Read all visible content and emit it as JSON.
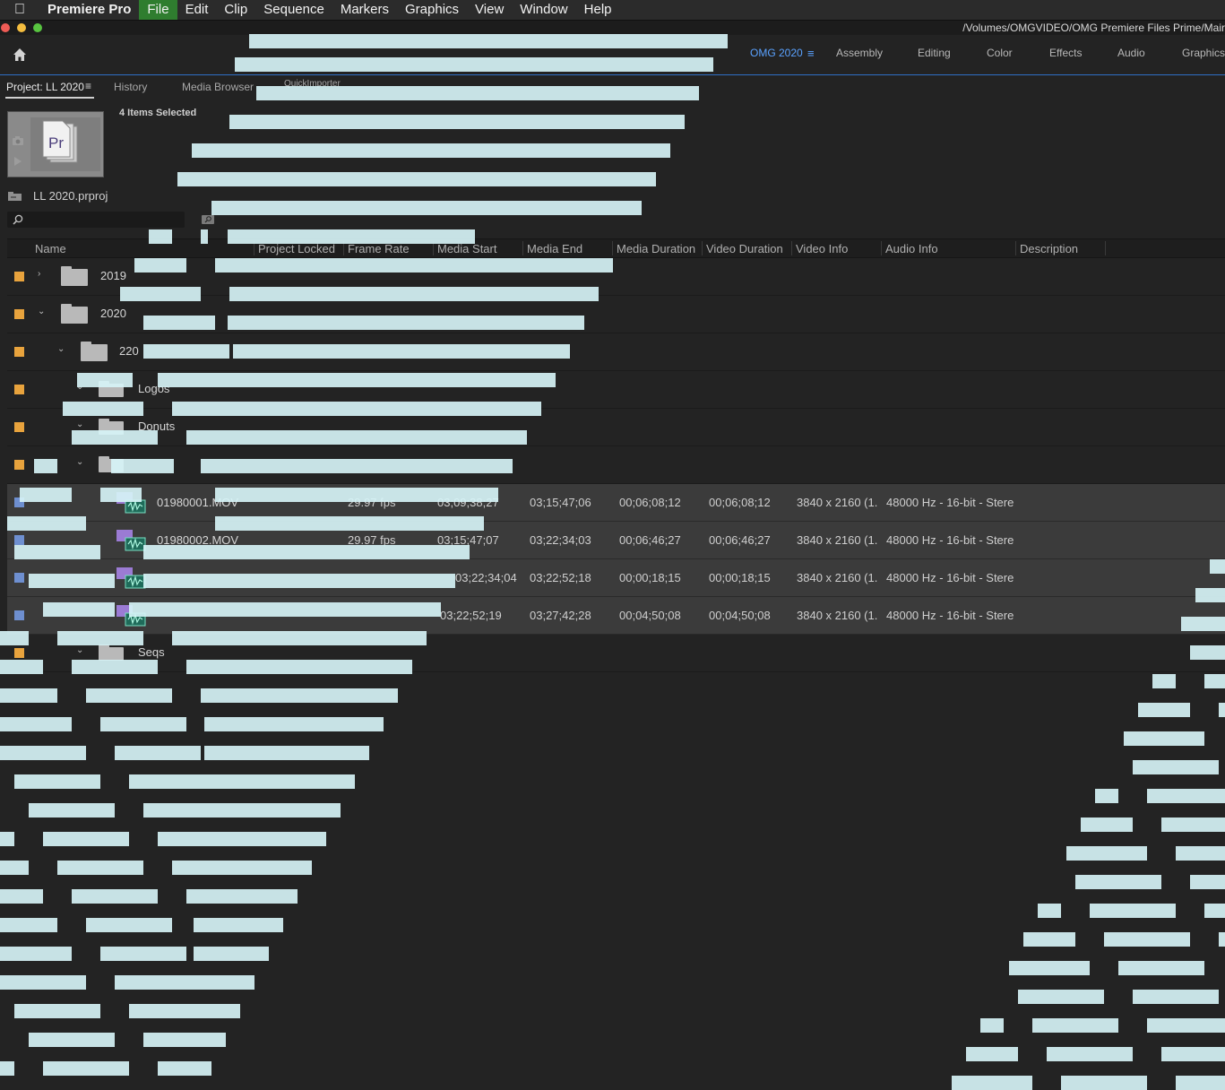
{
  "menubar": {
    "apple_icon": "apple-logo",
    "app_name": "Premiere Pro",
    "items": [
      "File",
      "Edit",
      "Clip",
      "Sequence",
      "Markers",
      "Graphics",
      "View",
      "Window",
      "Help"
    ],
    "active_item": "File"
  },
  "window": {
    "title": "/Volumes/OMGVIDEO/OMG Premiere Files Prime/Mair"
  },
  "workspaces": {
    "home_icon": "home-icon",
    "active": "OMG 2020",
    "tabs": [
      "OMG 2020",
      "Assembly",
      "Editing",
      "Color",
      "Effects",
      "Audio",
      "Graphics"
    ],
    "accent_color": "#5aa2ff"
  },
  "panel_tabs": {
    "project": "Project: LL 2020",
    "history": "History",
    "media_browser": "Media Browser",
    "quick_importer": "QuickImporter"
  },
  "project": {
    "items_selected": "4 Items Selected",
    "file_name": "LL 2020.prproj",
    "thumbnail_label": "Pr",
    "search_value": ""
  },
  "columns": [
    "Name",
    "Project Locked",
    "Frame Rate",
    "Media Start",
    "Media End",
    "Media Duration",
    "Video Duration",
    "Video Info",
    "Audio Info",
    "Description"
  ],
  "rows": [
    {
      "name": "2019",
      "type": "folder",
      "twisty": "›",
      "color": "#e8a33d"
    },
    {
      "name": "2020",
      "type": "folder",
      "twisty": "⌄",
      "color": "#e8a33d"
    },
    {
      "name": "220",
      "type": "folder",
      "twisty": "⌄",
      "color": "#e8a33d"
    },
    {
      "name": "Logos",
      "type": "folder",
      "twisty": "⌄",
      "color": "#e8a33d"
    },
    {
      "name": "Donuts",
      "type": "folder",
      "twisty": "⌄",
      "color": "#e8a33d"
    },
    {
      "name": "",
      "type": "folder",
      "twisty": "⌄",
      "color": "#e8a33d"
    },
    {
      "name": "01980001.MOV",
      "type": "clip",
      "color": "#6e8fd0",
      "frame_rate": "29.97 fps",
      "media_start": "03;09;38;27",
      "media_end": "03;15;47;06",
      "media_duration": "00;06;08;12",
      "video_duration": "00;06;08;12",
      "video_info": "3840 x 2160 (1.",
      "audio_info": "48000 Hz - 16-bit - Stere"
    },
    {
      "name": "01980002.MOV",
      "type": "clip",
      "color": "#6e8fd0",
      "frame_rate": "29.97 fps",
      "media_start": "03;15;47;07",
      "media_end": "03;22;34;03",
      "media_duration": "00;06;46;27",
      "video_duration": "00;06;46;27",
      "video_info": "3840 x 2160 (1.",
      "audio_info": "48000 Hz - 16-bit - Stere"
    },
    {
      "name": "",
      "type": "clip",
      "color": "#6e8fd0",
      "frame_rate": "",
      "media_start": "03;22;34;04",
      "media_end": "03;22;52;18",
      "media_duration": "00;00;18;15",
      "video_duration": "00;00;18;15",
      "video_info": "3840 x 2160 (1.",
      "audio_info": "48000 Hz - 16-bit - Stere"
    },
    {
      "name": "",
      "type": "clip",
      "color": "#6e8fd0",
      "frame_rate": "",
      "media_start": "03;22;52;19",
      "media_end": "03;27;42;28",
      "media_duration": "00;04;50;08",
      "video_duration": "00;04;50;08",
      "video_info": "3840 x 2160 (1.",
      "audio_info": "48000 Hz - 16-bit - Stere"
    },
    {
      "name": "Seqs",
      "type": "folder",
      "twisty": "⌄",
      "color": "#e8a33d"
    }
  ],
  "colors": {
    "folder_label": "#e8a33d",
    "clip_label": "#6e8fd0",
    "glitch": "#d6f3f6",
    "selection": "#3b3b3b"
  }
}
